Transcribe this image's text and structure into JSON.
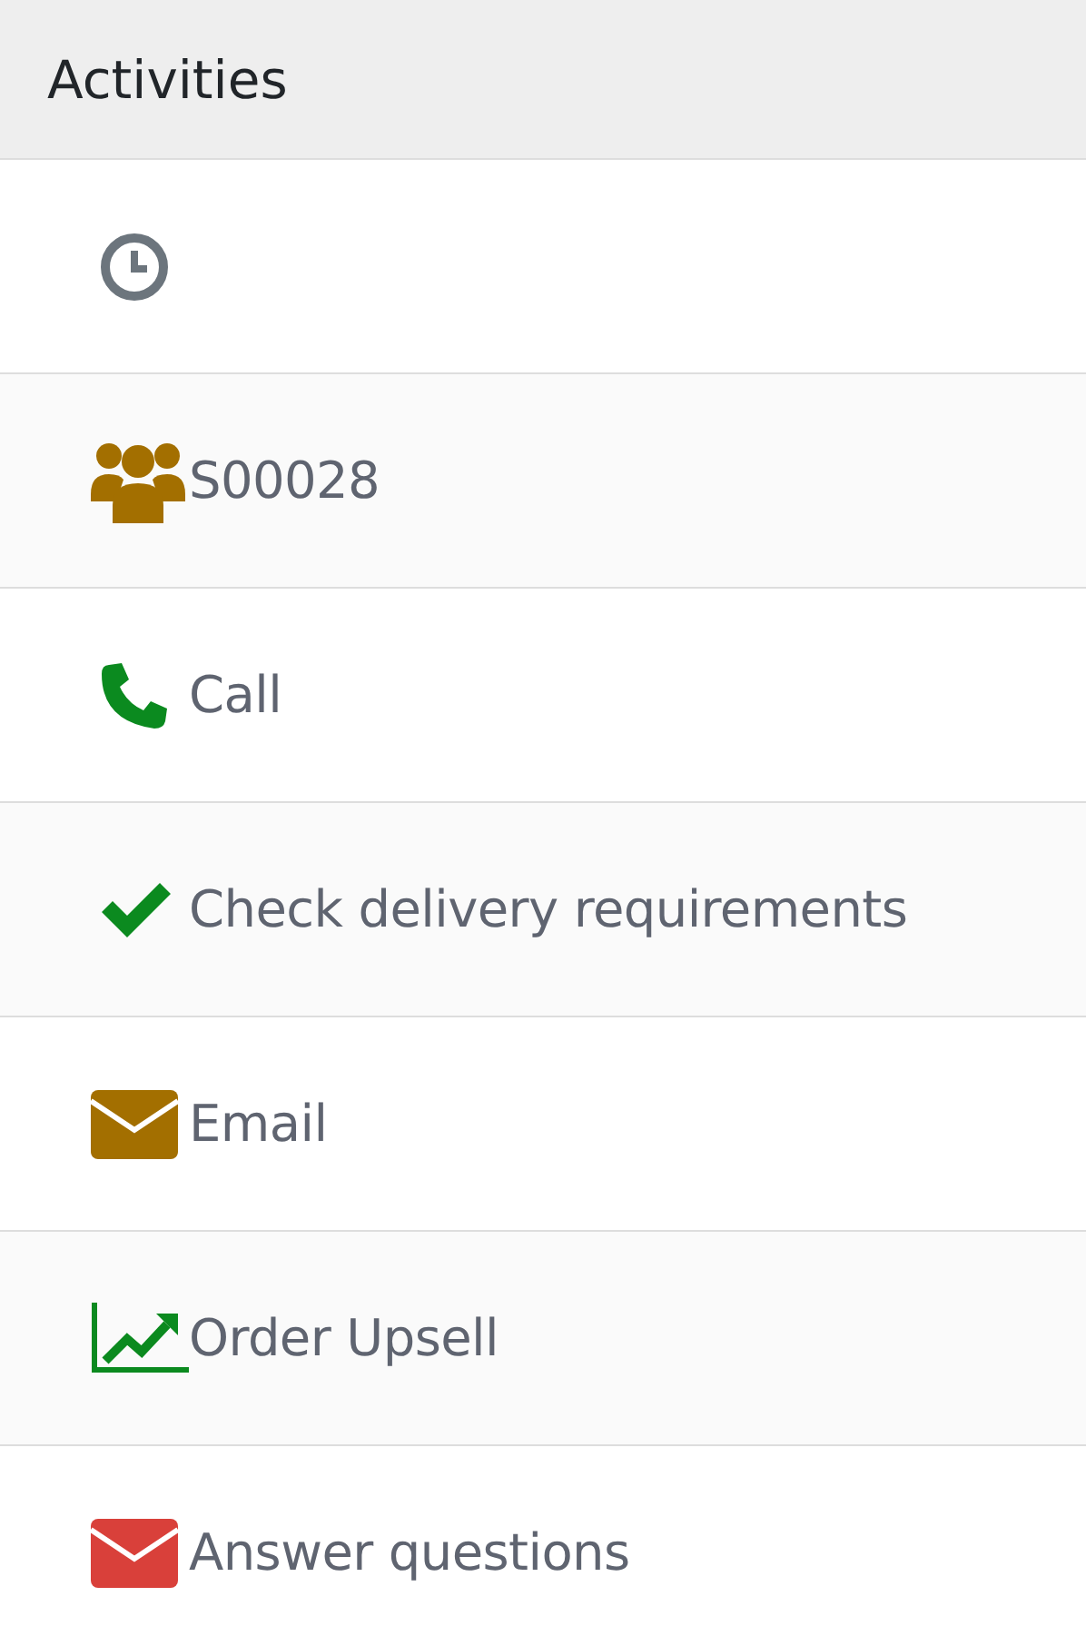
{
  "header": {
    "title": "Activities"
  },
  "activities": [
    {
      "kind": "clock",
      "color": "#6c757d"
    },
    {
      "kind": "meeting",
      "label": "S00028",
      "color": "#a36f00"
    },
    {
      "kind": "call",
      "label": "Call",
      "color": "#0b8a1f"
    },
    {
      "kind": "todo",
      "label": "Check delivery requirements",
      "color": "#0b8a1f"
    },
    {
      "kind": "email",
      "label": "Email",
      "color": "#a36f00"
    },
    {
      "kind": "upsell",
      "label": "Order Upsell",
      "color": "#0b8a1f"
    },
    {
      "kind": "email",
      "label": "Answer questions",
      "color": "#d9403a"
    }
  ]
}
